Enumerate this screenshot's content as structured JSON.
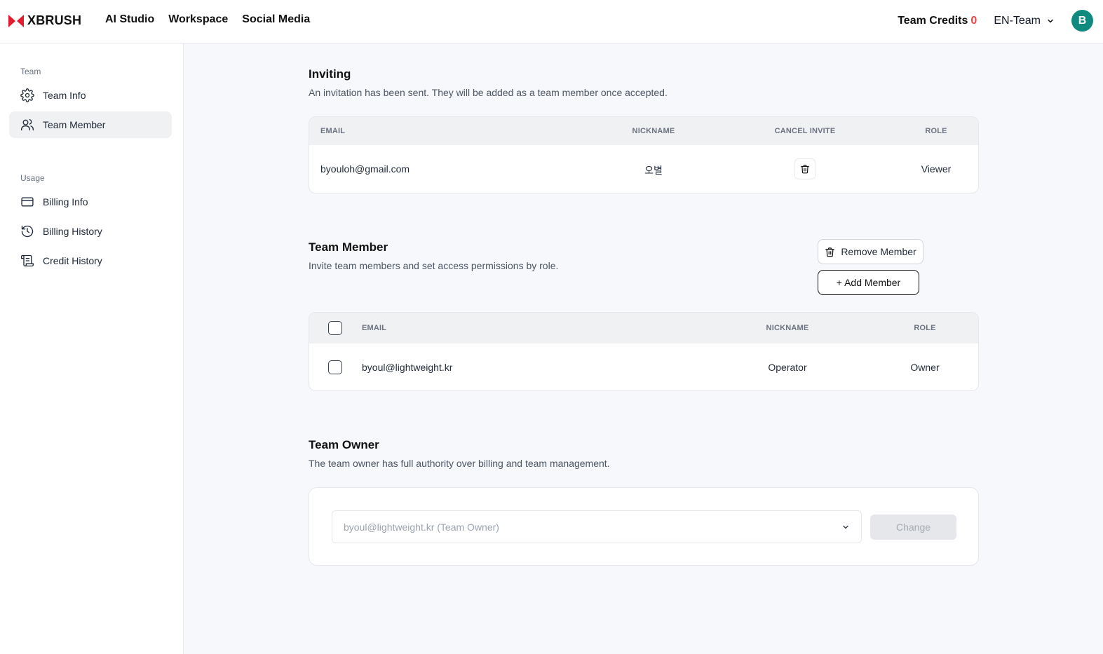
{
  "brand": {
    "name": "XBRUSH",
    "accent": "#e11d2e"
  },
  "nav": {
    "links": [
      "AI Studio",
      "Workspace",
      "Social Media"
    ],
    "credits_label": "Team Credits",
    "credits_value": "0",
    "team_name": "EN-Team",
    "avatar_initial": "B"
  },
  "sidebar": {
    "group_team": "Team",
    "group_usage": "Usage",
    "items": [
      {
        "label": "Team Info",
        "icon": "gear-icon"
      },
      {
        "label": "Team Member",
        "icon": "users-icon",
        "active": true
      },
      {
        "label": "Billing Info",
        "icon": "credit-card-icon"
      },
      {
        "label": "Billing History",
        "icon": "history-icon"
      },
      {
        "label": "Credit History",
        "icon": "scroll-icon"
      }
    ]
  },
  "inviting": {
    "title": "Inviting",
    "description": "An invitation has been sent. They will be added as a team member once accepted.",
    "columns": [
      "EMAIL",
      "NICKNAME",
      "CANCEL INVITE",
      "ROLE"
    ],
    "rows": [
      {
        "email": "byouloh@gmail.com",
        "nickname": "오별",
        "role": "Viewer"
      }
    ]
  },
  "team_member": {
    "title": "Team Member",
    "description": "Invite team members and set access permissions by role.",
    "remove_label": "Remove Member",
    "add_label": "+ Add Member",
    "columns": [
      "EMAIL",
      "NICKNAME",
      "ROLE"
    ],
    "rows": [
      {
        "email": "byoul@lightweight.kr",
        "nickname": "Operator",
        "role": "Owner"
      }
    ]
  },
  "team_owner": {
    "title": "Team Owner",
    "description": "The team owner has full authority over billing and team management.",
    "selected": "byoul@lightweight.kr (Team Owner)",
    "change_label": "Change"
  }
}
